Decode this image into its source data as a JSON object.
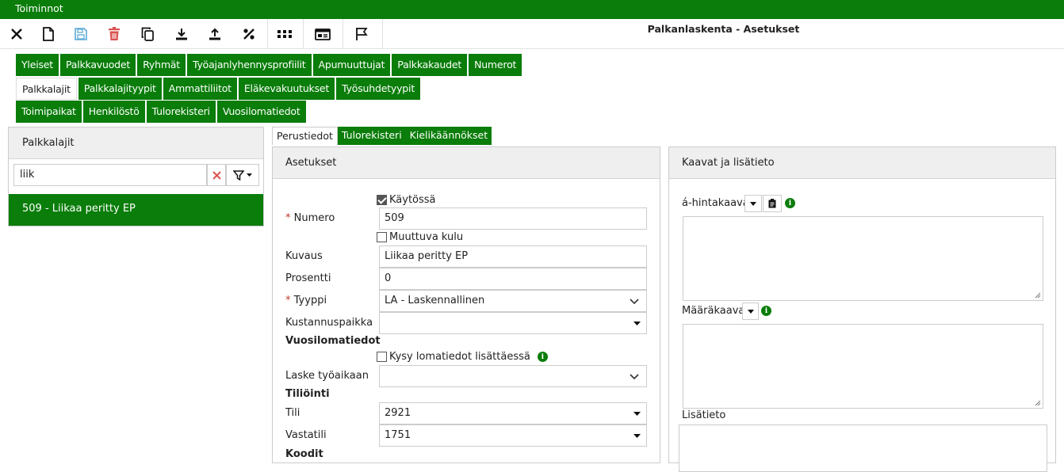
{
  "topbar": {
    "title": "Toiminnot"
  },
  "toolbar": {
    "app_title": "Palkanlaskenta - Asetukset",
    "icons": [
      "close-icon",
      "new-document-icon",
      "save-icon",
      "delete-icon",
      "copy-icon",
      "download-icon",
      "upload-icon",
      "percent-icon",
      "apps-grid-icon",
      "id-card-icon",
      "flag-icon"
    ]
  },
  "nav": {
    "row1": [
      "Yleiset",
      "Palkkavuodet",
      "Ryhmät",
      "Työajanlyhennysprofiilit",
      "Apumuuttujat",
      "Palkkakaudet",
      "Numerot"
    ],
    "row2": [
      "Palkkalajit",
      "Palkkalajityypit",
      "Ammattiliitot",
      "Eläkevakuutukset",
      "Työsuhdetyypit"
    ],
    "row3": [
      "Toimipaikat",
      "Henkilöstö",
      "Tulorekisteri",
      "Vuosilomatiedot"
    ],
    "active": "Palkkalajit"
  },
  "left_panel": {
    "title": "Palkkalajit",
    "search_value": "liik",
    "items": [
      "509 - Liikaa peritty EP"
    ]
  },
  "tabs": {
    "items": [
      "Perustiedot",
      "Tulorekisteri",
      "Kielikäännökset"
    ],
    "active": "Perustiedot"
  },
  "settings": {
    "title": "Asetukset",
    "kaytossa_label": "Käytössä",
    "kaytossa_checked": true,
    "numero_label": "Numero",
    "numero_value": "509",
    "muuttuva_label": "Muuttuva kulu",
    "muuttuva_checked": false,
    "kuvaus_label": "Kuvaus",
    "kuvaus_value": "Liikaa peritty EP",
    "prosentti_label": "Prosentti",
    "prosentti_value": "0",
    "tyyppi_label": "Tyyppi",
    "tyyppi_value": "LA - Laskennallinen",
    "kustannuspaikka_label": "Kustannuspaikka",
    "kustannuspaikka_value": "",
    "vuosiloma_section": "Vuosilomatiedot",
    "kysy_label": "Kysy lomatiedot lisättäessä",
    "kysy_checked": false,
    "laske_label": "Laske työaikaan",
    "laske_value": "",
    "tiliointi_section": "Tiliöinti",
    "tili_label": "Tili",
    "tili_value": "2921",
    "vastatili_label": "Vastatili",
    "vastatili_value": "1751",
    "koodit_section": "Koodit"
  },
  "formulas": {
    "title": "Kaavat ja lisätieto",
    "ahinta_label": "á-hintakaava",
    "maara_label": "Määräkaava",
    "lisatieto_label": "Lisätieto"
  },
  "colors": {
    "brand": "#0a7d0a",
    "delete": "#d9534f",
    "save": "#5aa9d6",
    "required": "#c0392b"
  }
}
